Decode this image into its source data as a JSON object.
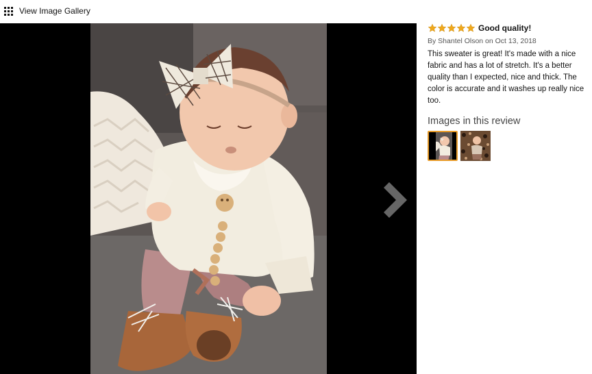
{
  "header": {
    "gallery_label": "View Image Gallery"
  },
  "viewer": {
    "next_icon": "chevron-right-icon"
  },
  "review": {
    "rating": 5,
    "rating_max": 5,
    "title": "Good quality!",
    "byline": "By Shantel Olson on Oct 13, 2018",
    "body": "This sweater is great! It's made with a nice fabric and has a lot of stretch. It's a better quality than I expected, nice and thick. The color is accurate and it washes up really nice too.",
    "images_heading": "Images in this review",
    "thumbnails": [
      {
        "selected": true
      },
      {
        "selected": false
      }
    ]
  },
  "colors": {
    "star": "#f0a81c",
    "selected_border": "#e89c2a",
    "viewer_bg": "#000000"
  }
}
